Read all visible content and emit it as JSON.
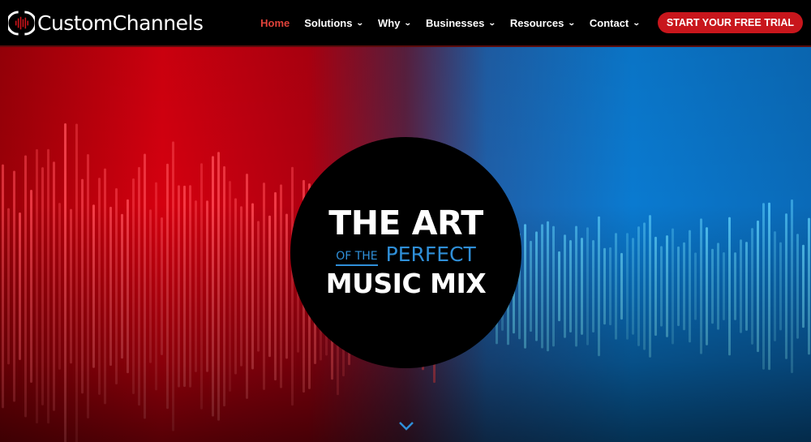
{
  "header": {
    "logo_text": "CustomChannels",
    "nav": [
      {
        "label": "Home",
        "active": true,
        "dropdown": false
      },
      {
        "label": "Solutions",
        "dropdown": true
      },
      {
        "label": "Why",
        "dropdown": true
      },
      {
        "label": "Businesses",
        "dropdown": true
      },
      {
        "label": "Resources",
        "dropdown": true
      },
      {
        "label": "Contact",
        "dropdown": true
      }
    ],
    "cta_label": "START YOUR FREE TRIAL",
    "chevron_glyph": "⌄"
  },
  "hero": {
    "line1": "THE ART",
    "line2_small": "OF THE",
    "line2_big": "PERFECT",
    "line3": "MUSIC MIX",
    "scroll_icon": "chevron-down-icon"
  },
  "colors": {
    "accent_red": "#c8161c",
    "accent_blue": "#2f8fd8",
    "active_nav": "#e0423a"
  }
}
